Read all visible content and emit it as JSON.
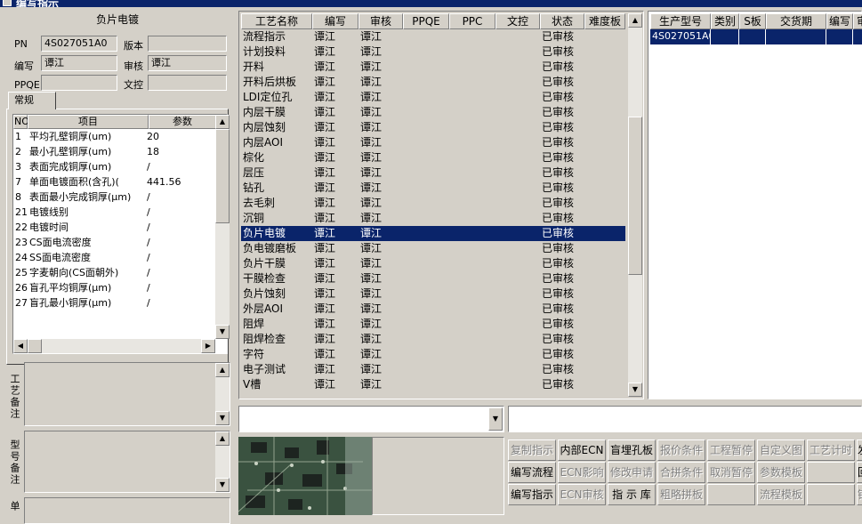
{
  "window": {
    "title": "编写指示"
  },
  "left": {
    "title": "负片电镀",
    "fields": {
      "pn_label": "PN",
      "pn_value": "4S027051A0",
      "version_label": "版本",
      "version_value": "",
      "author_label": "编写",
      "author_value": "谭江",
      "reviewer_label": "审核",
      "reviewer_value": "谭江",
      "ppqe_label": "PPQE",
      "ppqe_value": "",
      "control_label": "文控",
      "control_value": ""
    },
    "tab_label": "常规",
    "param_headers": [
      "NO",
      "项目",
      "参数"
    ],
    "params": [
      {
        "no": "1",
        "item": "平均孔壁铜厚(um)",
        "value": "20"
      },
      {
        "no": "2",
        "item": "最小孔壁铜厚(um)",
        "value": "18"
      },
      {
        "no": "3",
        "item": "表面完成铜厚(um)",
        "value": "/"
      },
      {
        "no": "7",
        "item": "单面电镀面积(含孔)(",
        "value": "441.56"
      },
      {
        "no": "8",
        "item": "表面最小完成铜厚(μm)",
        "value": "/"
      },
      {
        "no": "21",
        "item": "电镀线别",
        "value": "/"
      },
      {
        "no": "22",
        "item": "电镀时间",
        "value": "/"
      },
      {
        "no": "23",
        "item": "CS面电流密度",
        "value": "/"
      },
      {
        "no": "24",
        "item": "SS面电流密度",
        "value": "/"
      },
      {
        "no": "25",
        "item": "字麦朝向(CS面朝外)",
        "value": "/"
      },
      {
        "no": "26",
        "item": "盲孔平均铜厚(μm)",
        "value": "/"
      },
      {
        "no": "27",
        "item": "盲孔最小铜厚(μm)",
        "value": "/"
      }
    ],
    "memo_labels": [
      "工艺备注",
      "型号备注",
      "订单"
    ]
  },
  "process": {
    "headers": [
      "工艺名称",
      "编写",
      "审核",
      "PPQE",
      "PPC",
      "文控",
      "状态",
      "难度板"
    ],
    "selected_index": 13,
    "rows": [
      {
        "name": "流程指示",
        "author": "谭江",
        "reviewer": "谭江",
        "status": "已审核"
      },
      {
        "name": "计划投料",
        "author": "谭江",
        "reviewer": "谭江",
        "status": "已审核"
      },
      {
        "name": "开料",
        "author": "谭江",
        "reviewer": "谭江",
        "status": "已审核"
      },
      {
        "name": "开料后烘板",
        "author": "谭江",
        "reviewer": "谭江",
        "status": "已审核"
      },
      {
        "name": "LDI定位孔",
        "author": "谭江",
        "reviewer": "谭江",
        "status": "已审核"
      },
      {
        "name": "内层干膜",
        "author": "谭江",
        "reviewer": "谭江",
        "status": "已审核"
      },
      {
        "name": "内层蚀刻",
        "author": "谭江",
        "reviewer": "谭江",
        "status": "已审核"
      },
      {
        "name": "内层AOI",
        "author": "谭江",
        "reviewer": "谭江",
        "status": "已审核"
      },
      {
        "name": "棕化",
        "author": "谭江",
        "reviewer": "谭江",
        "status": "已审核"
      },
      {
        "name": "层压",
        "author": "谭江",
        "reviewer": "谭江",
        "status": "已审核"
      },
      {
        "name": "钻孔",
        "author": "谭江",
        "reviewer": "谭江",
        "status": "已审核"
      },
      {
        "name": "去毛刺",
        "author": "谭江",
        "reviewer": "谭江",
        "status": "已审核"
      },
      {
        "name": "沉铜",
        "author": "谭江",
        "reviewer": "谭江",
        "status": "已审核"
      },
      {
        "name": "负片电镀",
        "author": "谭江",
        "reviewer": "谭江",
        "status": "已审核"
      },
      {
        "name": "负电镀磨板",
        "author": "谭江",
        "reviewer": "谭江",
        "status": "已审核"
      },
      {
        "name": "负片干膜",
        "author": "谭江",
        "reviewer": "谭江",
        "status": "已审核"
      },
      {
        "name": "干膜检查",
        "author": "谭江",
        "reviewer": "谭江",
        "status": "已审核"
      },
      {
        "name": "负片蚀刻",
        "author": "谭江",
        "reviewer": "谭江",
        "status": "已审核"
      },
      {
        "name": "外层AOI",
        "author": "谭江",
        "reviewer": "谭江",
        "status": "已审核"
      },
      {
        "name": "阻焊",
        "author": "谭江",
        "reviewer": "谭江",
        "status": "已审核"
      },
      {
        "name": "阻焊检查",
        "author": "谭江",
        "reviewer": "谭江",
        "status": "已审核"
      },
      {
        "name": "字符",
        "author": "谭江",
        "reviewer": "谭江",
        "status": "已审核"
      },
      {
        "name": "电子测试",
        "author": "谭江",
        "reviewer": "谭江",
        "status": "已审核"
      },
      {
        "name": "V槽",
        "author": "谭江",
        "reviewer": "谭江",
        "status": "已审核"
      }
    ]
  },
  "products": {
    "headers": [
      "生产型号",
      "类别",
      "S板",
      "交货期",
      "编写",
      "审"
    ],
    "rows": [
      {
        "model": "4S027051A0"
      }
    ]
  },
  "buttons": [
    [
      {
        "label": "复制指示",
        "enabled": false
      },
      {
        "label": "内部ECN",
        "enabled": true
      },
      {
        "label": "盲埋孔板",
        "enabled": true
      },
      {
        "label": "报价条件",
        "enabled": false
      },
      {
        "label": "工程暂停",
        "enabled": false
      },
      {
        "label": "自定义图",
        "enabled": false
      },
      {
        "label": "工艺计时",
        "enabled": false
      },
      {
        "label": "发",
        "enabled": true
      }
    ],
    [
      {
        "label": "编写流程",
        "enabled": true
      },
      {
        "label": "ECN影响",
        "enabled": false
      },
      {
        "label": "修改申请",
        "enabled": false
      },
      {
        "label": "合拼条件",
        "enabled": false
      },
      {
        "label": "取消暂停",
        "enabled": false
      },
      {
        "label": "参数模板",
        "enabled": false
      },
      {
        "label": "",
        "enabled": false
      },
      {
        "label": "回",
        "enabled": true
      }
    ],
    [
      {
        "label": "编写指示",
        "enabled": true
      },
      {
        "label": "ECN审核",
        "enabled": false
      },
      {
        "label": "指 示 库",
        "enabled": true
      },
      {
        "label": "粗略拼板",
        "enabled": false
      },
      {
        "label": "",
        "enabled": false
      },
      {
        "label": "流程模板",
        "enabled": false
      },
      {
        "label": "",
        "enabled": false
      },
      {
        "label": "锁",
        "enabled": false
      }
    ]
  ]
}
